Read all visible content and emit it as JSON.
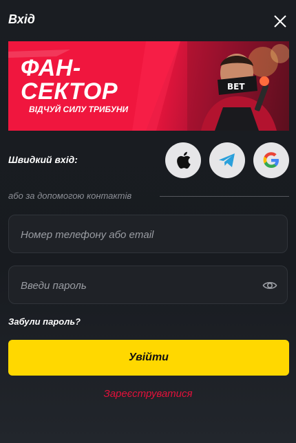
{
  "header": {
    "title": "Вхід",
    "close_icon": "close-icon"
  },
  "banner": {
    "title_line1": "ФАН-",
    "title_line2": "СЕКТОР",
    "subtitle": "ВІДЧУЙ СИЛУ ТРИБУНИ",
    "scarf_text": "BET",
    "accent_color": "#e80f3a"
  },
  "quick_login": {
    "label": "Швидкий вхід:",
    "providers": [
      {
        "icon": "apple-icon"
      },
      {
        "icon": "telegram-icon"
      },
      {
        "icon": "google-icon"
      }
    ]
  },
  "divider": {
    "text": "або за допомогою контактів"
  },
  "form": {
    "login_placeholder": "Номер телефону або email",
    "password_placeholder": "Введи пароль",
    "eye_icon": "eye-icon",
    "forgot_label": "Забули пароль?",
    "submit_label": "Увійти",
    "submit_color": "#ffd800"
  },
  "register": {
    "label": "Зареєструватися",
    "color": "#e4113b"
  }
}
